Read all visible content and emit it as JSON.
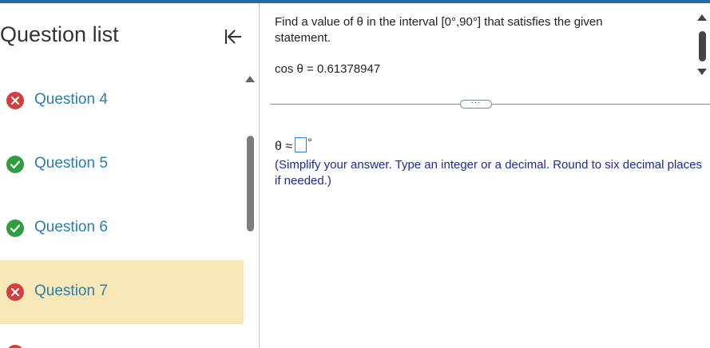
{
  "sidebar": {
    "title": "Question list",
    "items": [
      {
        "label": "Question 4",
        "status": "incorrect"
      },
      {
        "label": "Question 5",
        "status": "correct"
      },
      {
        "label": "Question 6",
        "status": "correct"
      },
      {
        "label": "Question 7",
        "status": "incorrect",
        "active": true
      }
    ],
    "icons": {
      "collapse": "collapse-left-icon",
      "incorrect": "x-circle-icon",
      "correct": "check-circle-icon"
    }
  },
  "question": {
    "prompt": "Find a value of θ in the interval [0°,90°] that satisfies the given statement.",
    "equation": "cos θ = 0.61378947",
    "more_button": "···",
    "answer_prefix": "θ ≈",
    "answer_value": "",
    "answer_unit": "°",
    "hint": "(Simplify your answer. Type an integer or a decimal. Round to six decimal places if needed.)"
  },
  "colors": {
    "accent": "#1f6e9b",
    "link": "#2a7ea8",
    "incorrect": "#d23f3f",
    "correct": "#2f9e41",
    "active_row": "#f8e7b6",
    "hint_text": "#1d2a9c"
  }
}
